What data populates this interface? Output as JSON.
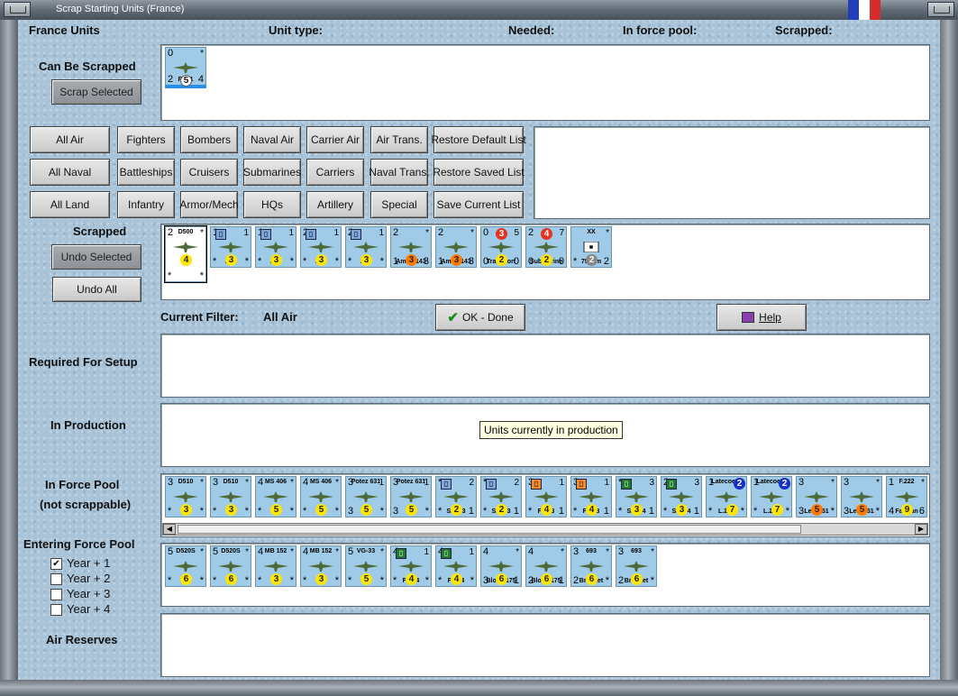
{
  "window": {
    "title": "Scrap Starting Units (France)",
    "flag_colors": [
      "#1f3fbf",
      "#ffffff",
      "#d62b2b"
    ]
  },
  "header": {
    "country_units": "France Units",
    "unit_type": "Unit type:",
    "needed": "Needed:",
    "in_force_pool": "In force pool:",
    "scrapped": "Scrapped:"
  },
  "can_be_scrapped": {
    "label": "Can Be Scrapped",
    "button": "Scrap Selected",
    "units": [
      {
        "tl": "0",
        "tr": "*",
        "bl": "2",
        "br": "4",
        "name": "F.221",
        "sub": "Farman",
        "disc": "5",
        "disc_color": "w",
        "selected": true
      }
    ]
  },
  "filters": {
    "row1": [
      "All Air",
      "Fighters",
      "Bombers",
      "Naval Air",
      "Carrier Air",
      "Air Trans.",
      "Restore Default List"
    ],
    "row2": [
      "All Naval",
      "Battleships",
      "Cruisers",
      "Submarines",
      "Carriers",
      "Naval Trans.",
      "Restore Saved List"
    ],
    "row3": [
      "All Land",
      "Infantry",
      "Armor/Mech",
      "HQs",
      "Artillery",
      "Special",
      "Save Current List"
    ]
  },
  "scrapped": {
    "label": "Scrapped",
    "undo_selected": "Undo Selected",
    "undo_all": "Undo All",
    "units": [
      {
        "tl": "2",
        "tr": "*",
        "bl": "*",
        "br": "*",
        "name": "D500",
        "disc": "4",
        "disc_color": "y",
        "top": true
      },
      {
        "tl": "1",
        "tr": "1",
        "bl": "*",
        "br": "*",
        "name": "F3F",
        "disc": "3",
        "disc_color": "y",
        "ibox": "blue"
      },
      {
        "tl": "1",
        "tr": "1",
        "bl": "*",
        "br": "*",
        "name": "F3F",
        "disc": "3",
        "disc_color": "y",
        "ibox": "blue"
      },
      {
        "tl": "2",
        "tr": "1",
        "bl": "*",
        "br": "*",
        "name": "F3F",
        "disc": "3",
        "disc_color": "y",
        "ibox": "blue"
      },
      {
        "tl": "2",
        "tr": "1",
        "bl": "*",
        "br": "*",
        "name": "F3F",
        "disc": "3",
        "disc_color": "y",
        "ibox": "blue"
      },
      {
        "tl": "2",
        "tr": "*",
        "bl": "1",
        "br": "3",
        "name": "Amiot 143",
        "disc": "3",
        "disc_color": "o"
      },
      {
        "tl": "2",
        "tr": "*",
        "bl": "1",
        "br": "3",
        "name": "Amiot 143",
        "disc": "3",
        "disc_color": "o"
      },
      {
        "tl": "0",
        "tr": "5",
        "bl": "0",
        "br": "0",
        "name": "Transport",
        "disc": "3",
        "disc_color": "r",
        "disc2": "2"
      },
      {
        "tl": "2",
        "tr": "7",
        "bl": "0",
        "br": "0",
        "name": "Submarine",
        "disc": "4",
        "disc_color": "r",
        "disc2": "2"
      },
      {
        "tl": "",
        "tr": "*",
        "bl": "*",
        "br": "2",
        "name": "75 mm",
        "disc": "2",
        "disc_color": "g",
        "xx": "XX"
      }
    ]
  },
  "current_filter": {
    "label": "Current Filter:",
    "value": "All Air"
  },
  "actions": {
    "ok": "OK - Done",
    "help": "Help"
  },
  "required_for_setup": {
    "label": "Required For Setup"
  },
  "in_production": {
    "label": "In Production",
    "tooltip": "Units currently in production"
  },
  "in_force_pool": {
    "label1": "In Force Pool",
    "label2": "(not scrappable)",
    "units": [
      {
        "tl": "3",
        "tr": "*",
        "bl": "*",
        "br": "*",
        "name": "D510",
        "disc": "3",
        "disc_color": "y",
        "top": true
      },
      {
        "tl": "3",
        "tr": "*",
        "bl": "*",
        "br": "*",
        "name": "D510",
        "disc": "3",
        "disc_color": "y",
        "top": true
      },
      {
        "tl": "4",
        "tr": "*",
        "bl": "*",
        "br": "*",
        "name": "MS 406",
        "disc": "5",
        "disc_color": "y",
        "top": true
      },
      {
        "tl": "4",
        "tr": "*",
        "bl": "*",
        "br": "*",
        "name": "MS 406",
        "disc": "5",
        "disc_color": "y",
        "top": true
      },
      {
        "tl": "3",
        "tr": "1",
        "bl": "3",
        "br": "*",
        "name": "Potez 631",
        "disc": "5",
        "disc_color": "y",
        "top": true
      },
      {
        "tl": "3",
        "tr": "1",
        "bl": "3",
        "br": "*",
        "name": "Potez 631",
        "disc": "5",
        "disc_color": "y",
        "top": true
      },
      {
        "tl": "*",
        "tr": "2",
        "bl": "*",
        "br": "1",
        "name": "SBC-3",
        "disc": "2",
        "disc_color": "y",
        "ibox": "blue"
      },
      {
        "tl": "*",
        "tr": "2",
        "bl": "*",
        "br": "1",
        "name": "SBC-3",
        "disc": "2",
        "disc_color": "y",
        "ibox": "blue"
      },
      {
        "tl": "3",
        "tr": "1",
        "bl": "*",
        "br": "1",
        "name": "F4F-3",
        "disc": "4",
        "disc_color": "y",
        "ibox": "orange"
      },
      {
        "tl": "3",
        "tr": "1",
        "bl": "*",
        "br": "1",
        "name": "F4F-3",
        "disc": "4",
        "disc_color": "y",
        "ibox": "orange"
      },
      {
        "tl": "*",
        "tr": "3",
        "bl": "*",
        "br": "1",
        "name": "SBC-4",
        "disc": "3",
        "disc_color": "y",
        "ibox": "green"
      },
      {
        "tl": "2",
        "tr": "3",
        "bl": "*",
        "br": "1",
        "name": "SBC-4",
        "disc": "3",
        "disc_color": "y",
        "ibox": "green"
      },
      {
        "tl": "1",
        "tr": "2",
        "bl": "*",
        "br": "*",
        "name": "L.298",
        "disc": "7",
        "disc_color": "y",
        "top_name": "Latecoere",
        "disc_top": "b"
      },
      {
        "tl": "1",
        "tr": "2",
        "bl": "*",
        "br": "*",
        "name": "L.298",
        "disc": "7",
        "disc_color": "y",
        "top_name": "Latecoere",
        "disc_top": "b"
      },
      {
        "tl": "3",
        "tr": "*",
        "bl": "3",
        "br": "*",
        "name": "LeO 451",
        "disc": "5",
        "disc_color": "o"
      },
      {
        "tl": "3",
        "tr": "*",
        "bl": "3",
        "br": "*",
        "name": "LeO 451",
        "disc": "5",
        "disc_color": "o"
      },
      {
        "tl": "1",
        "tr": "*",
        "bl": "4",
        "br": "6",
        "name": "Farman",
        "disc": "9",
        "disc_color": "y",
        "top_name": "F.222"
      }
    ]
  },
  "entering_force_pool": {
    "label": "Entering Force Pool",
    "years": [
      {
        "label": "Year + 1",
        "checked": true
      },
      {
        "label": "Year + 2",
        "checked": false
      },
      {
        "label": "Year + 3",
        "checked": false
      },
      {
        "label": "Year + 4",
        "checked": false
      }
    ],
    "units": [
      {
        "tl": "5",
        "tr": "*",
        "bl": "*",
        "br": "*",
        "name": "D520S",
        "disc": "6",
        "disc_color": "y",
        "top": true
      },
      {
        "tl": "5",
        "tr": "*",
        "bl": "*",
        "br": "*",
        "name": "D520S",
        "disc": "6",
        "disc_color": "y",
        "top": true
      },
      {
        "tl": "4",
        "tr": "*",
        "bl": "*",
        "br": "*",
        "name": "MB 152",
        "disc": "3",
        "disc_color": "y",
        "top": true
      },
      {
        "tl": "4",
        "tr": "*",
        "bl": "*",
        "br": "*",
        "name": "MB 152",
        "disc": "3",
        "disc_color": "y",
        "top": true
      },
      {
        "tl": "5",
        "tr": "*",
        "bl": "*",
        "br": "*",
        "name": "VG-33",
        "disc": "5",
        "disc_color": "y",
        "top": true
      },
      {
        "tl": "4",
        "tr": "1",
        "bl": "*",
        "br": "*",
        "name": "F4F-4",
        "disc": "4",
        "disc_color": "y",
        "ibox": "green"
      },
      {
        "tl": "4",
        "tr": "1",
        "bl": "*",
        "br": "*",
        "name": "F4F-4",
        "disc": "4",
        "disc_color": "y",
        "ibox": "green"
      },
      {
        "tl": "4",
        "tr": "*",
        "bl": "3",
        "br": "1",
        "name": "Bloch 175",
        "disc": "6",
        "disc_color": "y"
      },
      {
        "tl": "4",
        "tr": "*",
        "bl": "2",
        "br": "1",
        "name": "Bloch 175",
        "disc": "6",
        "disc_color": "y"
      },
      {
        "tl": "3",
        "tr": "*",
        "bl": "2",
        "br": "*",
        "name": "Breguet",
        "disc": "6",
        "disc_color": "y",
        "top_name": "693"
      },
      {
        "tl": "3",
        "tr": "*",
        "bl": "2",
        "br": "*",
        "name": "Breguet",
        "disc": "6",
        "disc_color": "y",
        "top_name": "693"
      }
    ]
  },
  "air_reserves": {
    "label": "Air Reserves"
  }
}
